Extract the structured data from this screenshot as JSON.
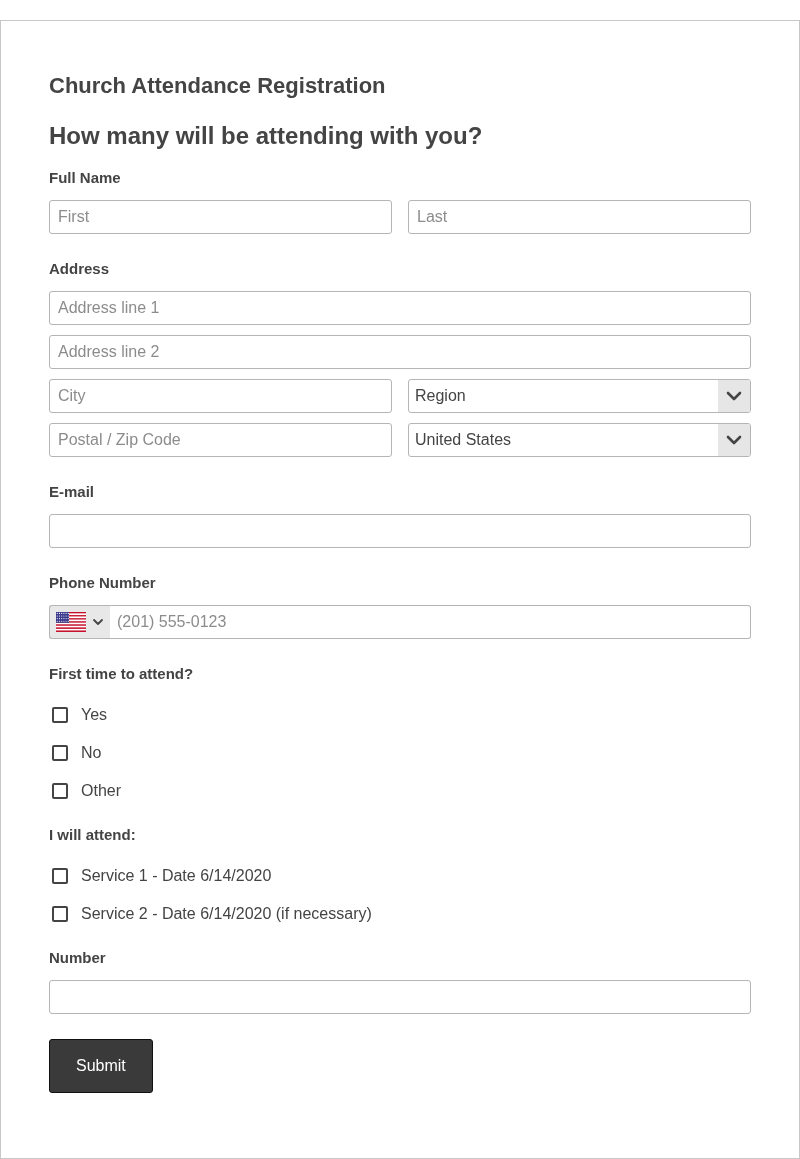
{
  "form": {
    "title": "Church Attendance Registration",
    "heading": "How many will be attending with you?"
  },
  "fields": [
    {
      "kind": "inputs",
      "label": "Full Name",
      "rows": [
        [
          {
            "kind": "input",
            "placeholder": "First"
          },
          {
            "kind": "input",
            "placeholder": "Last"
          }
        ]
      ]
    },
    {
      "kind": "inputs",
      "label": "Address",
      "rows": [
        [
          {
            "kind": "input",
            "placeholder": "Address line 1"
          }
        ],
        [
          {
            "kind": "input",
            "placeholder": "Address line 2"
          }
        ],
        [
          {
            "kind": "input",
            "placeholder": "City"
          },
          {
            "kind": "select",
            "value": "Region"
          }
        ],
        [
          {
            "kind": "input",
            "placeholder": "Postal / Zip Code"
          },
          {
            "kind": "select",
            "value": "United States"
          }
        ]
      ]
    },
    {
      "kind": "inputs",
      "label": "E-mail",
      "rows": [
        [
          {
            "kind": "input"
          }
        ]
      ]
    },
    {
      "kind": "inputs",
      "label": "Phone Number",
      "rows": [
        [
          {
            "kind": "phone",
            "placeholder": "(201) 555-0123"
          }
        ]
      ]
    },
    {
      "kind": "checkboxes",
      "label": "First time to attend?",
      "options": [
        {
          "label": "Yes",
          "checked": false
        },
        {
          "label": "No",
          "checked": false
        },
        {
          "label": "Other",
          "checked": false
        }
      ]
    },
    {
      "kind": "checkboxes",
      "label": "I will attend:",
      "options": [
        {
          "label": "Service 1 - Date 6/14/2020",
          "checked": false
        },
        {
          "label": "Service 2 - Date 6/14/2020 (if necessary)",
          "checked": false
        }
      ]
    },
    {
      "kind": "inputs",
      "label": "Number",
      "rows": [
        [
          {
            "kind": "input"
          }
        ]
      ]
    }
  ],
  "submit": {
    "label": "Submit"
  }
}
